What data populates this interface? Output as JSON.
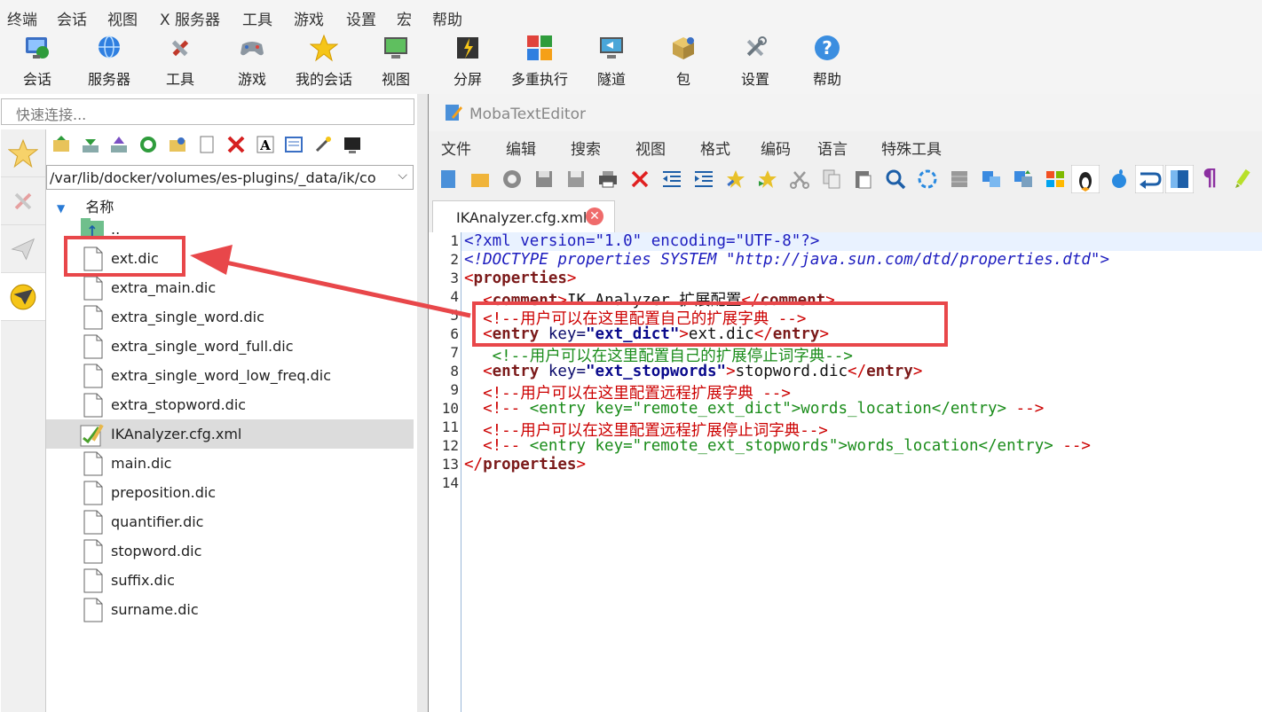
{
  "menubar": [
    "终端",
    "会话",
    "视图",
    "X 服务器",
    "工具",
    "游戏",
    "设置",
    "宏",
    "帮助"
  ],
  "toolbar": [
    {
      "label": "会话",
      "icon": "monitor-globe-icon"
    },
    {
      "label": "服务器",
      "icon": "globe-server-icon"
    },
    {
      "label": "工具",
      "icon": "tools-icon"
    },
    {
      "label": "游戏",
      "icon": "gamepad-icon"
    },
    {
      "label": "我的会话",
      "icon": "star-icon"
    },
    {
      "label": "视图",
      "icon": "view-monitor-icon"
    },
    {
      "label": "分屏",
      "icon": "split-screen-icon"
    },
    {
      "label": "多重执行",
      "icon": "multi-exec-icon"
    },
    {
      "label": "隧道",
      "icon": "tunnel-icon"
    },
    {
      "label": "包",
      "icon": "package-icon"
    },
    {
      "label": "设置",
      "icon": "settings-icon"
    },
    {
      "label": "帮助",
      "icon": "help-icon"
    }
  ],
  "quick_connect": {
    "placeholder": "快速连接..."
  },
  "browser": {
    "path": "/var/lib/docker/volumes/es-plugins/_data/ik/co",
    "column_header": "名称",
    "parent": "..",
    "files": [
      "ext.dic",
      "extra_main.dic",
      "extra_single_word.dic",
      "extra_single_word_full.dic",
      "extra_single_word_low_freq.dic",
      "extra_stopword.dic",
      "IKAnalyzer.cfg.xml",
      "main.dic",
      "preposition.dic",
      "quantifier.dic",
      "stopword.dic",
      "suffix.dic",
      "surname.dic"
    ],
    "selected": "IKAnalyzer.cfg.xml"
  },
  "editor": {
    "title": "MobaTextEditor",
    "menu": [
      "文件",
      "编辑",
      "搜索",
      "视图",
      "格式",
      "编码",
      "语言",
      "特殊工具"
    ],
    "tab": "IKAnalyzer.cfg.xml",
    "line_numbers": [
      "1",
      "2",
      "3",
      "4",
      "5",
      "6",
      "7",
      "8",
      "9",
      "10",
      "11",
      "12",
      "13",
      "14"
    ],
    "code": {
      "l1": "<?xml version=\"1.0\" encoding=\"UTF-8\"?>",
      "l2_a": "<!DOCTYPE properties SYSTEM ",
      "l2_b": "\"http://java.sun.com/dtd/properties.dtd\"",
      "l2_c": ">",
      "properties": "properties",
      "comment": "comment",
      "comment_text": "IK Analyzer 扩展配置",
      "entry": "entry",
      "key": "key=",
      "c5": "<!--用户可以在这里配置自己的扩展字典 -->",
      "v_ext_dict": "\"ext_dict\"",
      "ext_dic": "ext.dic",
      "c7": "<!--用户可以在这里配置自己的扩展停止词字典-->",
      "v_ext_stopwords": "\"ext_stopwords\"",
      "stopword_dic": "stopword.dic",
      "c9": "<!--用户可以在这里配置远程扩展字典 -->",
      "c10_open": "<!-- ",
      "c10_mid": "<entry key=\"remote_ext_dict\">words_location</entry>",
      "c10_close": " -->",
      "c11": "<!--用户可以在这里配置远程扩展停止词字典-->",
      "c12_mid": "<entry key=\"remote_ext_stopwords\">words_location</entry>"
    }
  },
  "colors": {
    "highlight": "#e8474a",
    "toolbar_bg": "#f4f4f4"
  }
}
